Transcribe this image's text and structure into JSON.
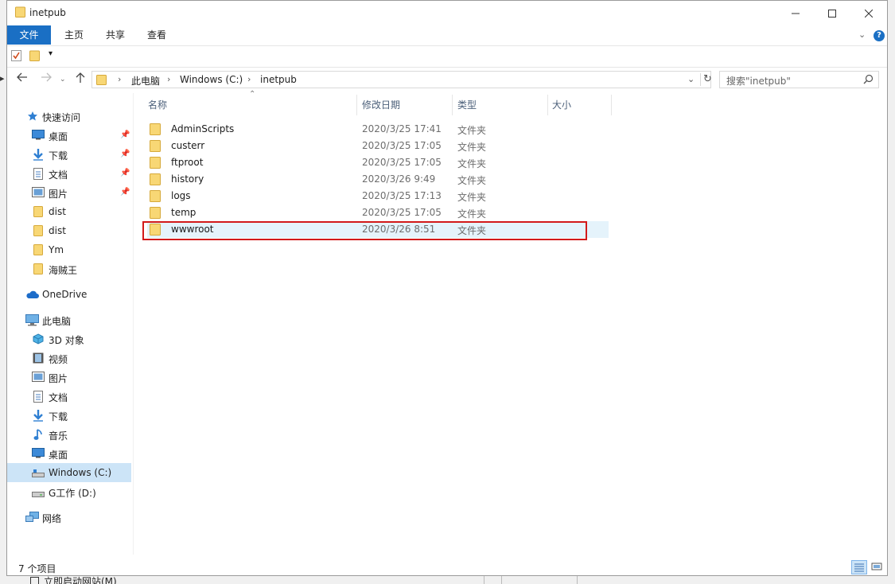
{
  "window": {
    "title": "inetpub"
  },
  "ribbon": {
    "tabs": [
      {
        "label": "文件"
      },
      {
        "label": "主页"
      },
      {
        "label": "共享"
      },
      {
        "label": "查看"
      }
    ],
    "help_label": "?"
  },
  "address": {
    "crumbs": [
      "此电脑",
      "Windows (C:)",
      "inetpub"
    ]
  },
  "search": {
    "placeholder": "搜索\"inetpub\""
  },
  "nav": {
    "quick_access": "快速访问",
    "items": [
      {
        "label": "桌面",
        "icon": "desktop-icon"
      },
      {
        "label": "下载",
        "icon": "download-icon"
      },
      {
        "label": "文档",
        "icon": "document-icon"
      },
      {
        "label": "图片",
        "icon": "pictures-icon"
      },
      {
        "label": "dist",
        "icon": "folder-icon"
      },
      {
        "label": "dist",
        "icon": "folder-icon"
      },
      {
        "label": "Ym",
        "icon": "folder-icon"
      },
      {
        "label": "海贼王",
        "icon": "folder-icon"
      }
    ],
    "onedrive": "OneDrive",
    "this_pc": "此电脑",
    "pc_items": [
      {
        "label": "3D 对象",
        "icon": "3d-objects-icon"
      },
      {
        "label": "视频",
        "icon": "videos-icon"
      },
      {
        "label": "图片",
        "icon": "pictures-icon"
      },
      {
        "label": "文档",
        "icon": "document-icon"
      },
      {
        "label": "下载",
        "icon": "download-icon"
      },
      {
        "label": "音乐",
        "icon": "music-icon"
      },
      {
        "label": "桌面",
        "icon": "desktop-icon"
      },
      {
        "label": "Windows (C:)",
        "icon": "drive-c-icon"
      },
      {
        "label": "G工作 (D:)",
        "icon": "drive-d-icon"
      }
    ],
    "network": "网络"
  },
  "columns": {
    "name": "名称",
    "modified": "修改日期",
    "type": "类型",
    "size": "大小"
  },
  "files": [
    {
      "name": "AdminScripts",
      "modified": "2020/3/25 17:41",
      "type": "文件夹"
    },
    {
      "name": "custerr",
      "modified": "2020/3/25 17:05",
      "type": "文件夹"
    },
    {
      "name": "ftproot",
      "modified": "2020/3/25 17:05",
      "type": "文件夹"
    },
    {
      "name": "history",
      "modified": "2020/3/26 9:49",
      "type": "文件夹"
    },
    {
      "name": "logs",
      "modified": "2020/3/25 17:13",
      "type": "文件夹"
    },
    {
      "name": "temp",
      "modified": "2020/3/25 17:05",
      "type": "文件夹"
    },
    {
      "name": "wwwroot",
      "modified": "2020/3/26 8:51",
      "type": "文件夹"
    }
  ],
  "status": {
    "item_count": "7 个项目"
  },
  "background": {
    "checkbox_label": "立即启动网站(M)"
  },
  "colors": {
    "accent": "#1a6fc4",
    "folder": "#f5c542",
    "highlight_box": "#d21a1a"
  }
}
